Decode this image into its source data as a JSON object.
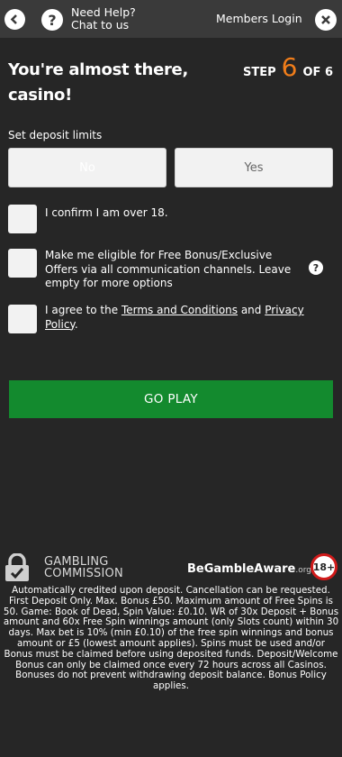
{
  "header": {
    "help_line1": "Need Help?",
    "help_line2": "Chat to us",
    "members_login": "Members Login",
    "help_glyph": "?"
  },
  "icons": {
    "back": "back-arrow-icon",
    "help": "question-icon",
    "close": "close-icon"
  },
  "title": {
    "line1": "You're almost there,",
    "line2": "casino!"
  },
  "step": {
    "prefix": "STEP",
    "current": "6",
    "suffix": "OF 6"
  },
  "deposit_limits": {
    "label": "Set deposit limits",
    "no": "No",
    "yes": "Yes"
  },
  "checkboxes": {
    "age": "I confirm I am over 18.",
    "marketing": "Make me eligible for Free Bonus/Exclusive Offers via all communication channels. Leave empty for more options",
    "terms_prefix": "I agree to the ",
    "terms_link": "Terms and Conditions",
    "terms_and": " and ",
    "privacy_link": "Privacy Policy",
    "terms_end": "."
  },
  "marketing_help_glyph": "?",
  "go_play": "GO PLAY",
  "footer": {
    "gc_line1": "GAMBLING",
    "gc_line2": "COMMISSION",
    "bga": "BeGambleAware",
    "bga_org": ".org",
    "age": "18+",
    "terms": "Automatically credited upon deposit. Cancellation can be requested. First Deposit Only. Max. Bonus £50. Maximum amount of Free Spins is 50. Game: Book of Dead, Spin Value: £0.10. WR of 30x Deposit + Bonus amount and 60x Free Spin winnings amount (only Slots count) within 30 days. Max bet is 10% (min £0.10) of the free spin winnings and bonus amount or £5 (lowest amount applies). Spins must be used and/or Bonus must be claimed before using deposited funds. Deposit/Welcome Bonus can only be claimed once every 72 hours across all Casinos. Bonuses do not prevent withdrawing deposit balance. Bonus Policy applies."
  },
  "colors": {
    "background": "#262626",
    "topbar": "#3a3a3a",
    "accent_orange": "#f07d1a",
    "go_green": "#138a2e",
    "age_red": "#d11b1b"
  }
}
